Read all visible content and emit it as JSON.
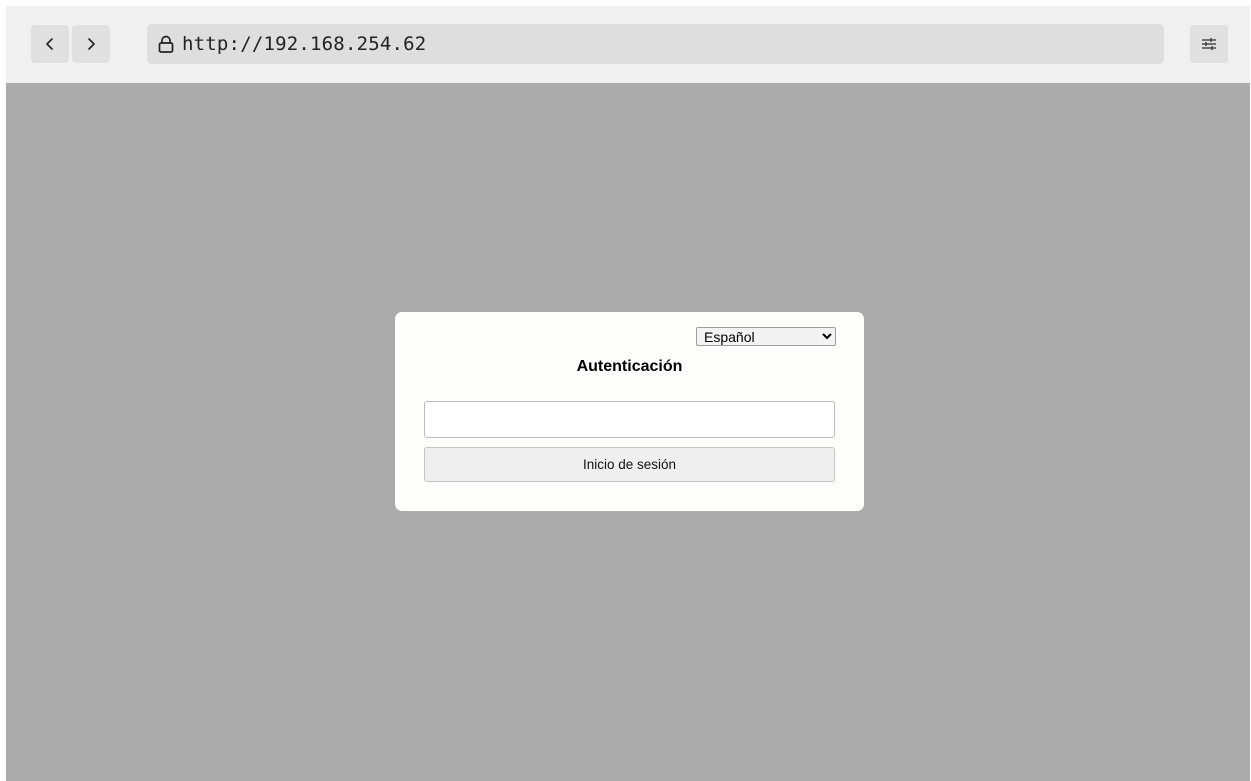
{
  "browser": {
    "back_icon": "chevron-left-icon",
    "forward_icon": "chevron-right-icon",
    "lock_icon": "lock-icon",
    "url": "http://192.168.254.62",
    "settings_icon": "sliders-icon"
  },
  "login": {
    "language": {
      "selected": "Español",
      "options": [
        "Español"
      ]
    },
    "title": "Autenticación",
    "input_value": "",
    "submit_label": "Inicio de sesión"
  },
  "colors": {
    "page_background": "#ababab",
    "toolbar_background": "#f0f0f0",
    "card_background": "#fdfdfb"
  }
}
